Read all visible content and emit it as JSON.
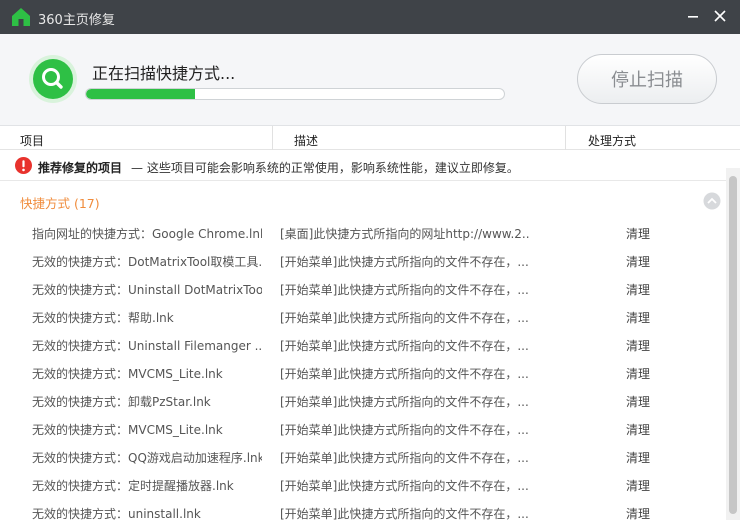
{
  "window": {
    "title": "360主页修复"
  },
  "scan": {
    "status_text": "正在扫描快捷方式...",
    "progress": 0.26,
    "stop_label": "停止扫描"
  },
  "columns": {
    "item": "项目",
    "desc": "描述",
    "action": "处理方式"
  },
  "recommend": {
    "title": "推荐修复的项目",
    "desc": "— 这些项目可能会影响系统的正常使用，影响系统性能，建议立即修复。"
  },
  "group": {
    "title": "快捷方式 (17)"
  },
  "rows": [
    {
      "item": "指向网址的快捷方式：Google Chrome.lnk",
      "desc": "[桌面]此快捷方式所指向的网址http://www.2...",
      "action": "清理"
    },
    {
      "item": "无效的快捷方式：DotMatrixTool取模工具.lnk",
      "desc": "[开始菜单]此快捷方式所指向的文件不存在，...",
      "action": "清理"
    },
    {
      "item": "无效的快捷方式：Uninstall DotMatrixTool.lnk",
      "desc": "[开始菜单]此快捷方式所指向的文件不存在，...",
      "action": "清理"
    },
    {
      "item": "无效的快捷方式：帮助.lnk",
      "desc": "[开始菜单]此快捷方式所指向的文件不存在，...",
      "action": "清理"
    },
    {
      "item": "无效的快捷方式：Uninstall Filemanger ...",
      "desc": "[开始菜单]此快捷方式所指向的文件不存在，...",
      "action": "清理"
    },
    {
      "item": "无效的快捷方式：MVCMS_Lite.lnk",
      "desc": "[开始菜单]此快捷方式所指向的文件不存在，...",
      "action": "清理"
    },
    {
      "item": "无效的快捷方式：卸载PzStar.lnk",
      "desc": "[开始菜单]此快捷方式所指向的文件不存在，...",
      "action": "清理"
    },
    {
      "item": "无效的快捷方式：MVCMS_Lite.lnk",
      "desc": "[开始菜单]此快捷方式所指向的文件不存在，...",
      "action": "清理"
    },
    {
      "item": "无效的快捷方式：QQ游戏启动加速程序.lnk",
      "desc": "[开始菜单]此快捷方式所指向的文件不存在，...",
      "action": "清理"
    },
    {
      "item": "无效的快捷方式：定时提醒播放器.lnk",
      "desc": "[开始菜单]此快捷方式所指向的文件不存在，...",
      "action": "清理"
    },
    {
      "item": "无效的快捷方式：uninstall.lnk",
      "desc": "[开始菜单]此快捷方式所指向的文件不存在，...",
      "action": "清理"
    }
  ],
  "icons": {
    "app": "home-icon",
    "minimize": "minimize-icon",
    "close": "close-icon",
    "scan": "search-icon",
    "warning": "warning-icon",
    "collapse": "chevron-up-icon"
  },
  "colors": {
    "titlebar": "#3f4348",
    "accent_green": "#2ec045",
    "group_orange": "#f08c3c",
    "warning_red": "#e8322d"
  }
}
